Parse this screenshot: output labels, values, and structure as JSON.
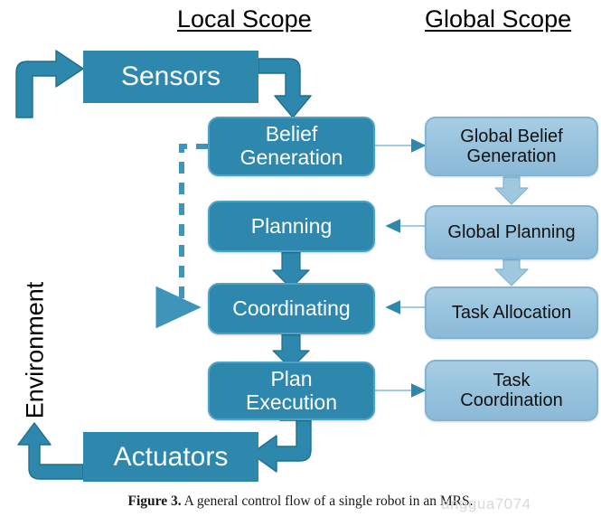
{
  "figure": {
    "caption_lead": "Figure 3.",
    "caption_text": "A general control flow of a single robot in an MRS.",
    "watermark": "anggua7074"
  },
  "headings": {
    "local": "Local Scope",
    "global": "Global Scope"
  },
  "environment": {
    "label": "Environment"
  },
  "colors": {
    "local_fill": "#2E88AE",
    "local_stroke": "#4FA2C4",
    "global_fill": "#96C2DD",
    "global_stroke": "#7FB4D4",
    "connector": "#9FCCE4",
    "arrow_head": "#2E88AE",
    "text_light": "#FFFFFF",
    "text_dark": "#111111",
    "background": "#FFFFFF"
  },
  "nodes": {
    "sensors": {
      "label": "Sensors",
      "scope": "local",
      "style": "hard"
    },
    "belief_generation": {
      "label": "Belief\nGeneration",
      "line1": "Belief",
      "line2": "Generation",
      "scope": "local"
    },
    "planning": {
      "label": "Planning",
      "scope": "local"
    },
    "coordinating": {
      "label": "Coordinating",
      "scope": "local"
    },
    "plan_execution": {
      "label": "Plan\nExecution",
      "line1": "Plan",
      "line2": "Execution",
      "scope": "local"
    },
    "actuators": {
      "label": "Actuators",
      "scope": "local",
      "style": "hard"
    },
    "global_belief_generation": {
      "label": "Global Belief\nGeneration",
      "line1": "Global Belief",
      "line2": "Generation",
      "scope": "global"
    },
    "global_planning": {
      "label": "Global Planning",
      "scope": "global"
    },
    "task_allocation": {
      "label": "Task Allocation",
      "scope": "global"
    },
    "task_coordination": {
      "label": "Task\nCoordination",
      "line1": "Task",
      "line2": "Coordination",
      "scope": "global"
    }
  },
  "edges": [
    {
      "name": "environment-to-sensors",
      "from": "environment",
      "to": "sensors",
      "style": "block-bend",
      "label": ""
    },
    {
      "name": "sensors-to-belief-generation",
      "from": "sensors",
      "to": "belief_generation",
      "style": "block-bend",
      "label": ""
    },
    {
      "name": "belief-generation-to-global-belief-generation",
      "from": "belief_generation",
      "to": "global_belief_generation",
      "style": "thin-line",
      "label": ""
    },
    {
      "name": "belief-generation-to-coordinating",
      "from": "belief_generation",
      "to": "coordinating",
      "style": "dashed",
      "label": ""
    },
    {
      "name": "planning-to-coordinating",
      "from": "planning",
      "to": "coordinating",
      "style": "block-down",
      "label": ""
    },
    {
      "name": "coordinating-to-plan-execution",
      "from": "coordinating",
      "to": "plan_execution",
      "style": "block-down",
      "label": ""
    },
    {
      "name": "plan-execution-to-actuators",
      "from": "plan_execution",
      "to": "actuators",
      "style": "block-bend",
      "label": ""
    },
    {
      "name": "actuators-to-environment",
      "from": "actuators",
      "to": "environment",
      "style": "block-bend",
      "label": ""
    },
    {
      "name": "global-belief-generation-to-global-planning",
      "from": "global_belief_generation",
      "to": "global_planning",
      "style": "block-down",
      "label": ""
    },
    {
      "name": "global-planning-to-task-allocation",
      "from": "global_planning",
      "to": "task_allocation",
      "style": "block-down",
      "label": ""
    },
    {
      "name": "global-planning-to-planning",
      "from": "global_planning",
      "to": "planning",
      "style": "thin-line",
      "label": ""
    },
    {
      "name": "task-allocation-to-coordinating",
      "from": "task_allocation",
      "to": "coordinating",
      "style": "thin-line",
      "label": ""
    },
    {
      "name": "plan-execution-to-task-coordination",
      "from": "plan_execution",
      "to": "task_coordination",
      "style": "thin-line",
      "label": ""
    }
  ]
}
